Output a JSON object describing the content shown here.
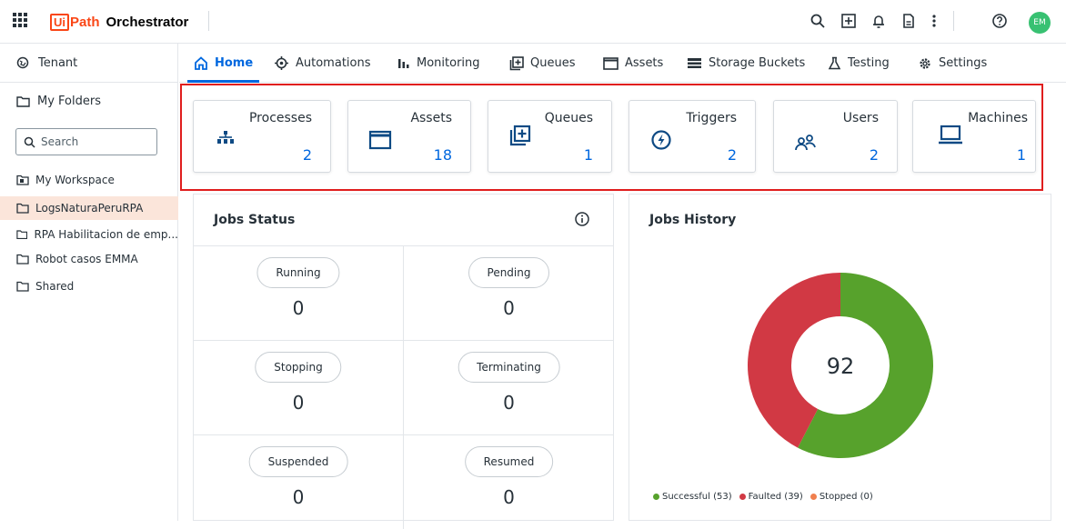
{
  "header": {
    "logo_ui": "Ui",
    "logo_path": "Path",
    "logo_orch": "Orchestrator",
    "avatar": "EM",
    "icons": [
      "apps-grid-icon",
      "search-icon",
      "add-box-icon",
      "bell-icon",
      "document-icon",
      "more-vert-icon",
      "help-icon"
    ]
  },
  "sidebar": {
    "tenant_label": "Tenant",
    "my_folders_label": "My Folders",
    "search_placeholder": "Search",
    "folders": [
      "My Workspace",
      "LogsNaturaPeruRPA",
      "RPA Habilitacion de emp...",
      "Robot casos EMMA",
      "Shared"
    ],
    "active_folder": "LogsNaturaPeruRPA"
  },
  "tabs": [
    "Home",
    "Automations",
    "Monitoring",
    "Queues",
    "Assets",
    "Storage Buckets",
    "Testing",
    "Settings"
  ],
  "active_tab": "Home",
  "cards": [
    {
      "label": "Processes",
      "value": "2",
      "icon": "sitemap-icon"
    },
    {
      "label": "Assets",
      "value": "18",
      "icon": "window-icon"
    },
    {
      "label": "Queues",
      "value": "1",
      "icon": "queue-add-icon"
    },
    {
      "label": "Triggers",
      "value": "2",
      "icon": "lightning-icon"
    },
    {
      "label": "Users",
      "value": "2",
      "icon": "users-icon"
    },
    {
      "label": "Machines",
      "value": "1",
      "icon": "laptop-icon"
    }
  ],
  "jobs_status": {
    "title": "Jobs Status",
    "items": [
      {
        "label": "Running",
        "value": "0"
      },
      {
        "label": "Pending",
        "value": "0"
      },
      {
        "label": "Stopping",
        "value": "0"
      },
      {
        "label": "Terminating",
        "value": "0"
      },
      {
        "label": "Suspended",
        "value": "0"
      },
      {
        "label": "Resumed",
        "value": "0"
      }
    ]
  },
  "jobs_history": {
    "title": "Jobs History",
    "total": "92",
    "legend": [
      {
        "label": "Successful (53)",
        "color": "#57a22c"
      },
      {
        "label": "Faulted (39)",
        "color": "#d13944"
      },
      {
        "label": "Stopped (0)",
        "color": "#f07f4e"
      }
    ]
  },
  "chart_data": {
    "type": "pie",
    "categories": [
      "Successful",
      "Faulted",
      "Stopped"
    ],
    "values": [
      53,
      39,
      0
    ],
    "colors": [
      "#57a22c",
      "#d13944",
      "#f07f4e"
    ],
    "center_label": "92"
  }
}
